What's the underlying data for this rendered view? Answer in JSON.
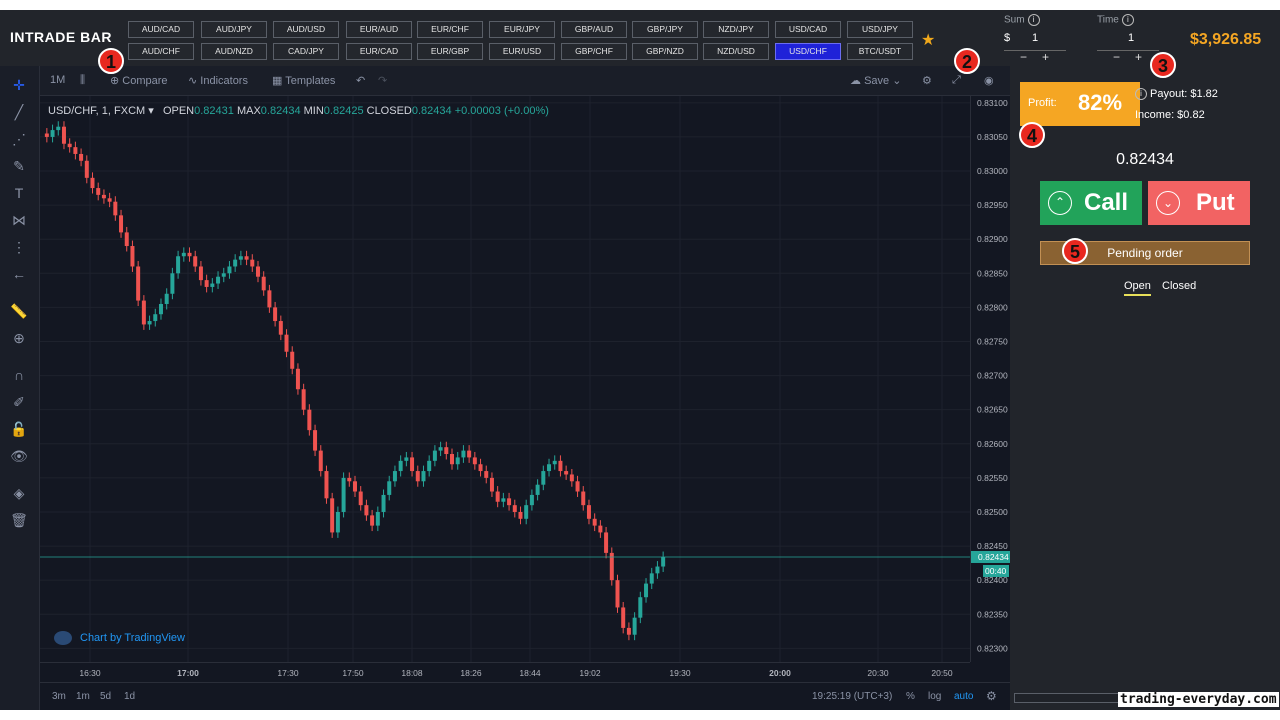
{
  "brand": "INTRADE BAR",
  "pairs_row1": [
    "AUD/CAD",
    "AUD/JPY",
    "AUD/USD",
    "EUR/AUD",
    "EUR/CHF",
    "EUR/JPY",
    "GBP/AUD",
    "GBP/JPY",
    "NZD/JPY",
    "USD/CAD",
    "USD/JPY"
  ],
  "pairs_row2": [
    "AUD/CHF",
    "AUD/NZD",
    "CAD/JPY",
    "EUR/CAD",
    "EUR/GBP",
    "EUR/USD",
    "GBP/CHF",
    "GBP/NZD",
    "NZD/USD",
    "USD/CHF",
    "BTC/USDT"
  ],
  "selected_pair": "USD/CHF",
  "sum": {
    "label": "Sum",
    "currency": "$",
    "value": "1"
  },
  "time": {
    "label": "Time",
    "value": "1"
  },
  "balance": "$3,926.85",
  "toolbar": {
    "interval": "1M",
    "compare": "Compare",
    "indicators": "Indicators",
    "templates": "Templates",
    "save": "Save"
  },
  "legend": {
    "symbol": "USD/CHF, 1, FXCM",
    "open_label": "OPEN",
    "open": "0.82431",
    "max_label": "MAX",
    "max": "0.82434",
    "min_label": "MIN",
    "min": "0.82425",
    "closed_label": "CLOSED",
    "closed": "0.82434",
    "change": "+0.00003 (+0.00%)"
  },
  "price_ticks": [
    "0.83100",
    "0.83050",
    "0.83000",
    "0.82950",
    "0.82900",
    "0.82850",
    "0.82800",
    "0.82750",
    "0.82700",
    "0.82650",
    "0.82600",
    "0.82550",
    "0.82500",
    "0.82450",
    "0.82400",
    "0.82350",
    "0.82300"
  ],
  "time_ticks": [
    "16:30",
    "17:00",
    "17:30",
    "17:50",
    "18:08",
    "18:26",
    "18:44",
    "19:02",
    "19:30",
    "20:00",
    "20:30",
    "20:50"
  ],
  "current_price_tag": "0.82434",
  "countdown_tag": "00:40",
  "watermark": "Chart by TradingView",
  "ranges": [
    "3m",
    "1m",
    "5d",
    "1d"
  ],
  "clock": "19:25:19 (UTC+3)",
  "scale_opts": [
    "%",
    "log",
    "auto"
  ],
  "profit": {
    "label": "Profit:",
    "value": "82%"
  },
  "payout": "Payout: $1.82",
  "income": "Income: $0.82",
  "price": "0.82434",
  "call": "Call",
  "put": "Put",
  "pending": "Pending order",
  "tabs": [
    "Open",
    "Closed"
  ],
  "footer": "trading-everyday.com",
  "markers": [
    "1",
    "2",
    "3",
    "4",
    "5"
  ],
  "colors": {
    "up": "#26a69a",
    "down": "#ef5350",
    "call": "#22a35a",
    "put": "#f26363",
    "profit": "#f5a623",
    "accent": "#f5a623"
  },
  "chart_data": {
    "type": "candlestick",
    "title": "USD/CHF, 1, FXCM",
    "ylim": [
      0.8228,
      0.8311
    ],
    "start_time": "16:14",
    "interval_minutes": 1,
    "close": [
      0.8305,
      0.8306,
      0.83065,
      0.8304,
      0.83035,
      0.83025,
      0.83015,
      0.8299,
      0.82975,
      0.82965,
      0.8296,
      0.82955,
      0.82935,
      0.8291,
      0.8289,
      0.8286,
      0.8281,
      0.82775,
      0.8278,
      0.8279,
      0.82805,
      0.8282,
      0.8285,
      0.82875,
      0.8288,
      0.82875,
      0.8286,
      0.8284,
      0.8283,
      0.82835,
      0.82845,
      0.8285,
      0.8286,
      0.8287,
      0.82875,
      0.8287,
      0.8286,
      0.82845,
      0.82825,
      0.828,
      0.8278,
      0.8276,
      0.82735,
      0.8271,
      0.8268,
      0.8265,
      0.8262,
      0.8259,
      0.8256,
      0.8252,
      0.8247,
      0.825,
      0.8255,
      0.82545,
      0.8253,
      0.8251,
      0.82495,
      0.8248,
      0.825,
      0.82525,
      0.82545,
      0.8256,
      0.82575,
      0.8258,
      0.8256,
      0.82545,
      0.8256,
      0.82575,
      0.8259,
      0.82595,
      0.82585,
      0.8257,
      0.8258,
      0.8259,
      0.8258,
      0.8257,
      0.8256,
      0.8255,
      0.8253,
      0.82515,
      0.8252,
      0.8251,
      0.825,
      0.8249,
      0.8251,
      0.82525,
      0.8254,
      0.8256,
      0.8257,
      0.82575,
      0.8256,
      0.82555,
      0.82545,
      0.8253,
      0.8251,
      0.8249,
      0.8248,
      0.8247,
      0.8244,
      0.824,
      0.8236,
      0.8233,
      0.8232,
      0.82345,
      0.82375,
      0.82395,
      0.8241,
      0.8242,
      0.82434
    ]
  }
}
